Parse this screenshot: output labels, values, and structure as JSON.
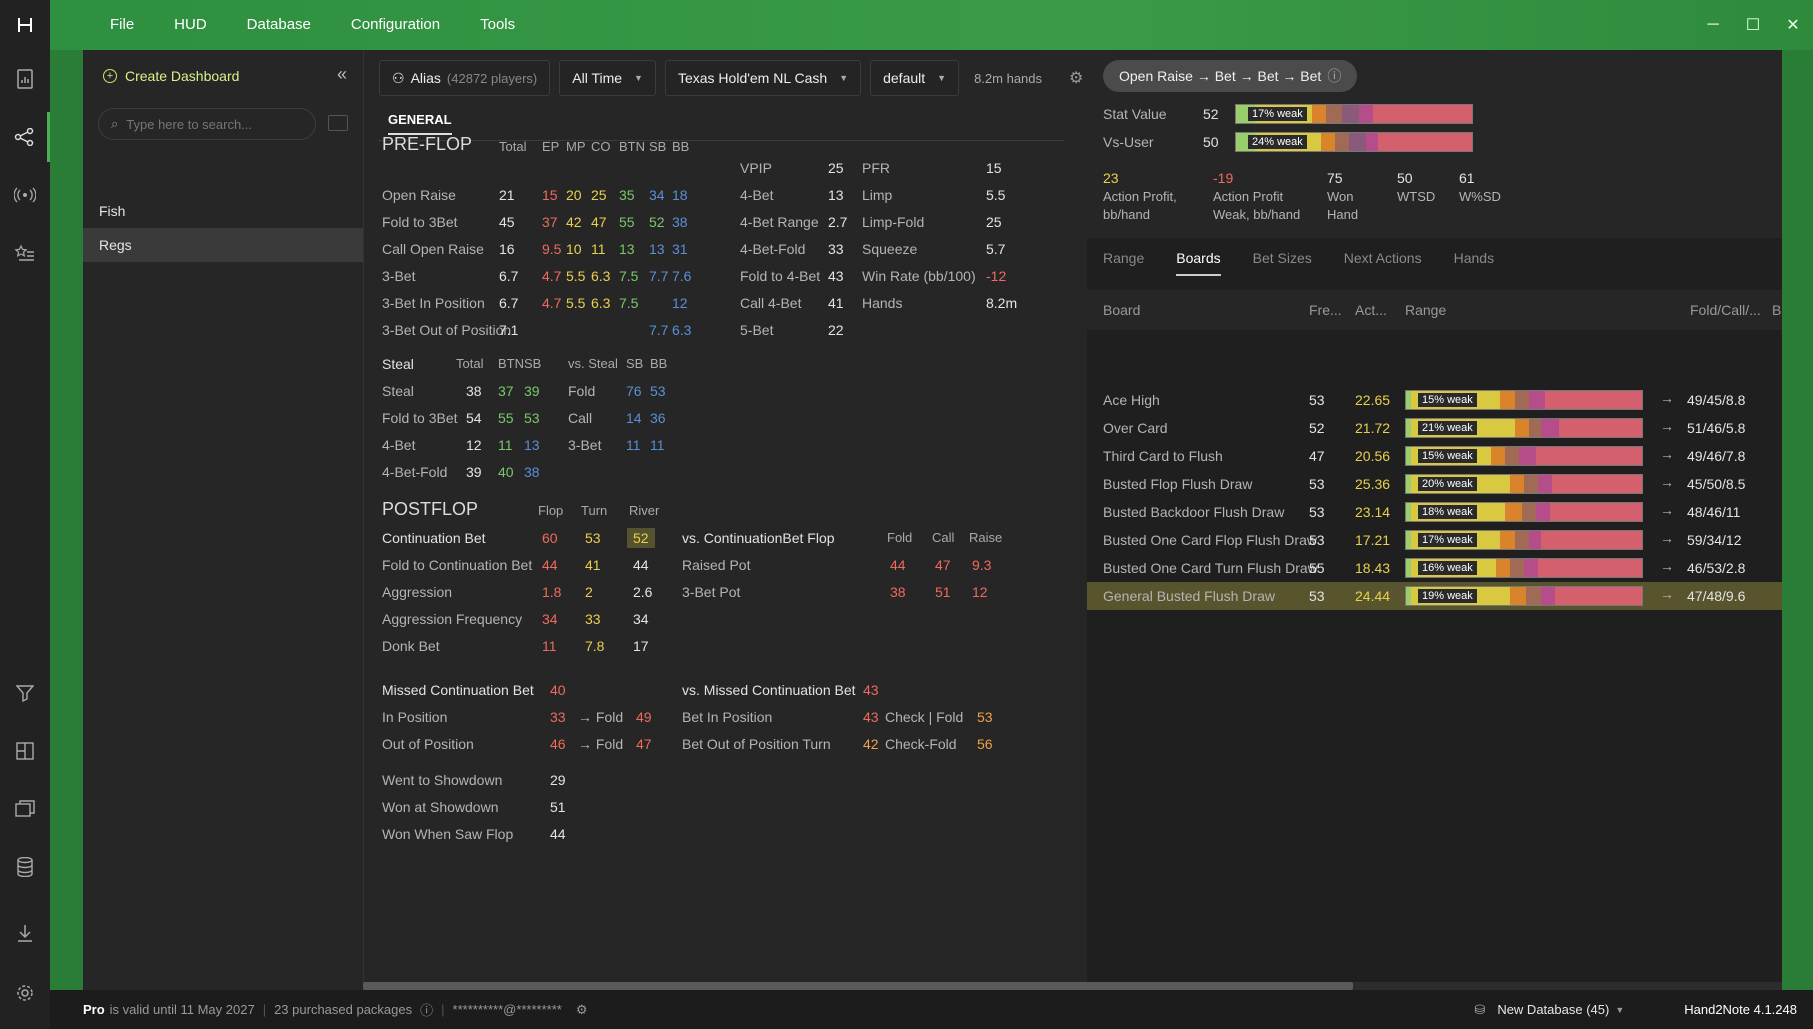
{
  "menu": [
    "File",
    "HUD",
    "Database",
    "Configuration",
    "Tools"
  ],
  "sidebar": {
    "create_label": "Create Dashboard",
    "search_placeholder": "Type here to search...",
    "items": [
      "Fish",
      "Regs"
    ]
  },
  "toolbar": {
    "alias": "Alias",
    "players": "(42872 players)",
    "time": "All Time",
    "game": "Texas Hold'em NL Cash",
    "profile": "default",
    "hands": "8.2m hands"
  },
  "tab": "GENERAL",
  "preflop": {
    "title": "PRE-FLOP",
    "headers": [
      "Total",
      "EP",
      "MP",
      "CO",
      "BTN",
      "SB",
      "BB"
    ],
    "rows": [
      {
        "label": "Open Raise",
        "vals": [
          "21",
          "15",
          "20",
          "25",
          "35",
          "34",
          "18"
        ]
      },
      {
        "label": "Fold to 3Bet",
        "vals": [
          "45",
          "37",
          "42",
          "47",
          "55",
          "52",
          "38"
        ]
      },
      {
        "label": "Call Open Raise",
        "vals": [
          "16",
          "9.5",
          "10",
          "11",
          "13",
          "13",
          "31"
        ]
      },
      {
        "label": "3-Bet",
        "vals": [
          "6.7",
          "4.7",
          "5.5",
          "6.3",
          "7.5",
          "7.7",
          "7.6"
        ]
      },
      {
        "label": "3-Bet In Position",
        "vals": [
          "6.7",
          "4.7",
          "5.5",
          "6.3",
          "7.5",
          "",
          "12"
        ]
      },
      {
        "label": "3-Bet Out of Position",
        "vals": [
          "7.1",
          "",
          "",
          "",
          "",
          "7.7",
          "6.3"
        ]
      }
    ],
    "col2": [
      {
        "label": "VPIP",
        "val": "25"
      },
      {
        "label": "4-Bet",
        "val": "13"
      },
      {
        "label": "4-Bet Range",
        "val": "2.7"
      },
      {
        "label": "4-Bet-Fold",
        "val": "33"
      },
      {
        "label": "Fold to 4-Bet",
        "val": "43"
      },
      {
        "label": "Call 4-Bet",
        "val": "41"
      },
      {
        "label": "5-Bet",
        "val": "22"
      }
    ],
    "col3": [
      {
        "label": "PFR",
        "val": "15"
      },
      {
        "label": "Limp",
        "val": "5.5"
      },
      {
        "label": "Limp-Fold",
        "val": "25"
      },
      {
        "label": "Squeeze",
        "val": "5.7"
      },
      {
        "label": "Win Rate (bb/100)",
        "val": "-12"
      },
      {
        "label": "Hands",
        "val": "8.2m"
      }
    ]
  },
  "steal": {
    "title": "Steal",
    "headers": [
      "Total",
      "BTN",
      "SB"
    ],
    "rows": [
      {
        "label": "Steal",
        "vals": [
          "38",
          "37",
          "39"
        ]
      },
      {
        "label": "Fold to 3Bet",
        "vals": [
          "54",
          "55",
          "53"
        ]
      },
      {
        "label": "4-Bet",
        "vals": [
          "12",
          "11",
          "13"
        ]
      },
      {
        "label": "4-Bet-Fold",
        "vals": [
          "39",
          "40",
          "38"
        ]
      }
    ],
    "vs_title": "vs. Steal",
    "vs_headers": [
      "SB",
      "BB"
    ],
    "vs_rows": [
      {
        "label": "Fold",
        "vals": [
          "76",
          "53"
        ]
      },
      {
        "label": "Call",
        "vals": [
          "14",
          "36"
        ]
      },
      {
        "label": "3-Bet",
        "vals": [
          "11",
          "11"
        ]
      }
    ]
  },
  "postflop": {
    "title": "POSTFLOP",
    "headers": [
      "Flop",
      "Turn",
      "River"
    ],
    "rows": [
      {
        "label": "Continuation Bet",
        "vals": [
          "60",
          "53",
          "52"
        ]
      },
      {
        "label": "Fold to Continuation Bet",
        "vals": [
          "44",
          "41",
          "44"
        ]
      },
      {
        "label": "Aggression",
        "vals": [
          "1.8",
          "2",
          "2.6"
        ]
      },
      {
        "label": "Aggression Frequency",
        "vals": [
          "34",
          "33",
          "34"
        ]
      },
      {
        "label": "Donk Bet",
        "vals": [
          "11",
          "7.8",
          "17"
        ]
      }
    ],
    "vs_title": "vs. ContinuationBet Flop",
    "vs_headers": [
      "Fold",
      "Call",
      "Raise"
    ],
    "vs_rows": [
      {
        "label": "Raised Pot",
        "vals": [
          "44",
          "47",
          "9.3"
        ]
      },
      {
        "label": "3-Bet Pot",
        "vals": [
          "38",
          "51",
          "12"
        ]
      }
    ],
    "missed_title": "Missed Continuation Bet",
    "missed_val": "40",
    "missed_rows": [
      {
        "label": "In Position",
        "val": "33",
        "fold": "→ Fold",
        "fval": "49"
      },
      {
        "label": "Out of Position",
        "val": "46",
        "fold": "→ Fold",
        "fval": "47"
      }
    ],
    "vs_missed_title": "vs. Missed Continuation Bet",
    "vs_missed_val": "43",
    "vs_missed_rows": [
      {
        "label": "Bet In Position",
        "val": "43",
        "act": "Check | Fold",
        "aval": "53"
      },
      {
        "label": "Bet Out of Position Turn",
        "val": "42",
        "act": "Check-Fold",
        "aval": "56"
      }
    ],
    "showdown": [
      {
        "label": "Went to Showdown",
        "val": "29"
      },
      {
        "label": "Won at Showdown",
        "val": "51"
      },
      {
        "label": "Won When Saw Flop",
        "val": "44"
      }
    ]
  },
  "right": {
    "path": "Open Raise → Bet → Bet → Bet",
    "stat_value_label": "Stat Value",
    "stat_value": "52",
    "stat_tag": "17% weak",
    "vs_user_label": "Vs-User",
    "vs_user": "50",
    "vs_tag": "24% weak",
    "summary": [
      {
        "val": "23",
        "label": "Action Profit, bb/hand",
        "color": "y"
      },
      {
        "val": "-19",
        "label": "Action Profit Weak, bb/hand",
        "color": "r"
      },
      {
        "val": "75",
        "label": "Won Hand",
        "color": "v"
      },
      {
        "val": "50",
        "label": "WTSD",
        "color": "v"
      },
      {
        "val": "61",
        "label": "W%SD",
        "color": "v"
      }
    ],
    "tabs": [
      "Range",
      "Boards",
      "Bet Sizes",
      "Next Actions",
      "Hands"
    ],
    "columns": [
      "Board",
      "Fre...",
      "Act...",
      "Range",
      "Fold/Call/...",
      "B"
    ],
    "boards": [
      {
        "name": "Ace High",
        "freq": "53",
        "act": "22.65",
        "tag": "15% weak",
        "fcr": "49/45/8.8"
      },
      {
        "name": "Over Card",
        "freq": "52",
        "act": "21.72",
        "tag": "21% weak",
        "fcr": "51/46/5.8"
      },
      {
        "name": "Third Card to Flush",
        "freq": "47",
        "act": "20.56",
        "tag": "15% weak",
        "fcr": "49/46/7.8"
      },
      {
        "name": "Busted Flop Flush Draw",
        "freq": "53",
        "act": "25.36",
        "tag": "20% weak",
        "fcr": "45/50/8.5"
      },
      {
        "name": "Busted Backdoor Flush Draw",
        "freq": "53",
        "act": "23.14",
        "tag": "18% weak",
        "fcr": "48/46/11"
      },
      {
        "name": "Busted One Card Flop Flush Draw",
        "freq": "53",
        "act": "17.21",
        "tag": "17% weak",
        "fcr": "59/34/12"
      },
      {
        "name": "Busted One Card Turn Flush Draw",
        "freq": "55",
        "act": "18.43",
        "tag": "16% weak",
        "fcr": "46/53/2.8"
      },
      {
        "name": "General Busted Flush Draw",
        "freq": "53",
        "act": "24.44",
        "tag": "19% weak",
        "fcr": "47/48/9.6"
      }
    ]
  },
  "status": {
    "plan": "Pro",
    "valid": "is valid until 11 May 2027",
    "packages": "23 purchased packages",
    "email": "**********@*********",
    "database": "New Database (45)",
    "version": "Hand2Note 4.1.248"
  }
}
